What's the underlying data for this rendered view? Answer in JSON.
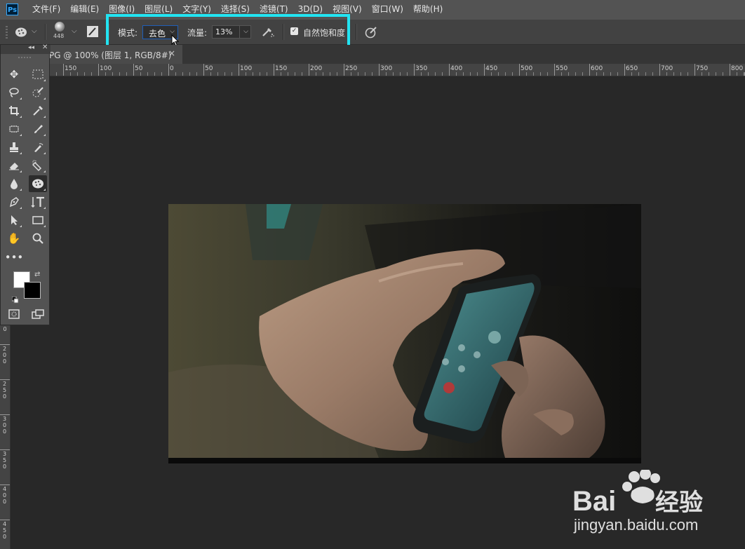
{
  "app": {
    "logo": "Ps"
  },
  "menu": [
    "文件(F)",
    "编辑(E)",
    "图像(I)",
    "图层(L)",
    "文字(Y)",
    "选择(S)",
    "滤镜(T)",
    "3D(D)",
    "视图(V)",
    "窗口(W)",
    "帮助(H)"
  ],
  "options": {
    "brush_size": "448",
    "mode_label": "模式:",
    "mode_value": "去色",
    "flow_label": "流量:",
    "flow_value": "13%",
    "vibrance_label": "自然饱和度",
    "vibrance_checked": true
  },
  "document": {
    "tab_title": "PG @ 100% (图层 1, RGB/8#)",
    "close_glyph": "×"
  },
  "rulers": {
    "horizontal": [
      "150",
      "100",
      "50",
      "0",
      "50",
      "100",
      "150",
      "200",
      "250",
      "300",
      "350",
      "400",
      "450",
      "500",
      "550",
      "600",
      "650",
      "700",
      "750",
      "800"
    ],
    "vertical": [
      "0",
      "2 0 0",
      "2 5 0",
      "3 0 0",
      "3 5 0",
      "4 0 0",
      "4 5 0"
    ]
  },
  "toolbar": {
    "active_tool": "sponge-tool",
    "foreground_color": "#ffffff",
    "background_color": "#000000"
  },
  "watermark": {
    "brand": "Bai",
    "brand_cn": "经验",
    "url": "jingyan.baidu.com"
  },
  "colors": {
    "highlight": "#22e4f2",
    "menubar": "#535353",
    "workspace": "#282828"
  }
}
